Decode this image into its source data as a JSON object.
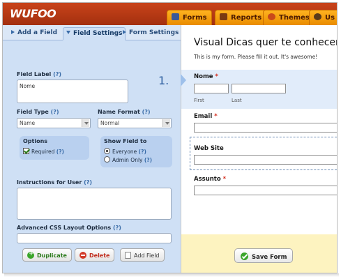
{
  "header": {
    "logo": "WUFOO",
    "nav": [
      {
        "label": "Forms",
        "icon": "forms-icon"
      },
      {
        "label": "Reports",
        "icon": "reports-icon"
      },
      {
        "label": "Themes",
        "icon": "themes-icon"
      },
      {
        "label": "Us",
        "icon": "users-icon"
      }
    ]
  },
  "subtabs": [
    "Add a Field",
    "Field Settings",
    "Form Settings"
  ],
  "settings": {
    "field_label": "Field Label",
    "field_label_help": "(?)",
    "field_label_value": "Nome",
    "field_type": "Field Type",
    "field_type_help": "(?)",
    "field_type_value": "Name",
    "name_format": "Name Format",
    "name_format_help": "(?)",
    "name_format_value": "Normal",
    "options_title": "Options",
    "required_label": "Required",
    "required_help": "(?)",
    "show_field_title": "Show Field to",
    "everyone_label": "Everyone",
    "everyone_help": "(?)",
    "admin_label": "Admin Only",
    "admin_help": "(?)",
    "instructions": "Instructions for User",
    "instructions_help": "(?)",
    "css_layout": "Advanced CSS Layout Options",
    "css_layout_help": "(?)",
    "buttons": {
      "duplicate": "Duplicate",
      "delete": "Delete",
      "add_field": "Add Field"
    }
  },
  "form": {
    "title": "Visual Dicas quer te conhecer",
    "description": "This is my form. Please fill it out. It's awesome!",
    "number": "1.",
    "fields": {
      "nome": "Nome",
      "first": "First",
      "last": "Last",
      "email": "Email",
      "website": "Web Site",
      "assunto": "Assunto",
      "required_mark": "*"
    },
    "save": "Save Form"
  },
  "colors": {
    "header": "#b8391a",
    "nav_tab": "#f6a210",
    "panel": "#cfe0f5",
    "save_bar": "#fdf3c0"
  }
}
